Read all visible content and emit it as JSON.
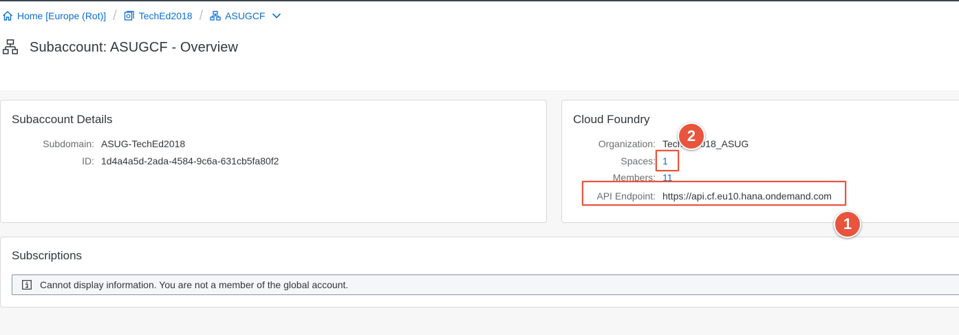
{
  "breadcrumb": {
    "home": {
      "label": "Home [Europe (Rot)]",
      "icon": "home-icon"
    },
    "global_account": {
      "label": "TechEd2018",
      "icon": "global-account-icon"
    },
    "subaccount": {
      "label": "ASUGCF",
      "icon": "subaccount-icon"
    },
    "separator": "/"
  },
  "page": {
    "title": "Subaccount: ASUGCF - Overview",
    "icon": "subaccount-hierarchy-icon"
  },
  "subaccount_details": {
    "title": "Subaccount Details",
    "subdomain_label": "Subdomain:",
    "subdomain_value": "ASUG-TechEd2018",
    "id_label": "ID:",
    "id_value": "1d4a4a5d-2ada-4584-9c6a-631cb5fa80f2"
  },
  "cloud_foundry": {
    "title": "Cloud Foundry",
    "organization_label": "Organization:",
    "organization_value": "TechEd2018_ASUG",
    "spaces_label": "Spaces:",
    "spaces_value": "1",
    "members_label": "Members:",
    "members_value": "11",
    "api_endpoint_label": "API Endpoint:",
    "api_endpoint_value": "https://api.cf.eu10.hana.ondemand.com"
  },
  "subscriptions": {
    "title": "Subscriptions",
    "message": "Cannot display information. You are not a member of the global account.",
    "message_icon": "info-icon"
  },
  "callouts": [
    {
      "number": "1",
      "target": "api-endpoint"
    },
    {
      "number": "2",
      "target": "spaces"
    }
  ],
  "colors": {
    "link": "#0a6ed1",
    "text": "#32363a",
    "label": "#6a6d70",
    "callout": "#e8543d",
    "background": "#f7f7f7"
  }
}
